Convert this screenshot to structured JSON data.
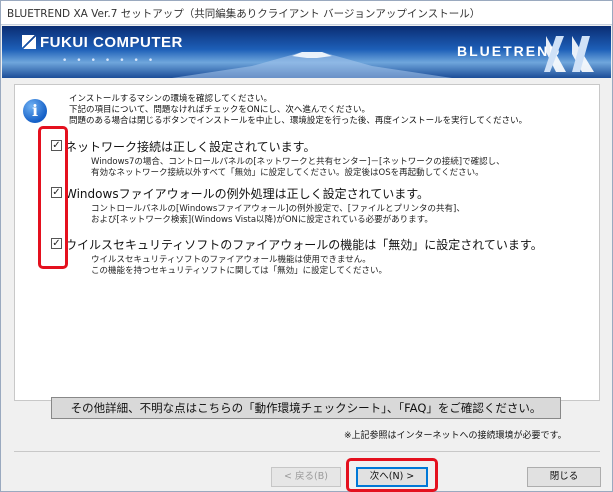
{
  "window": {
    "title": "BLUETREND XA Ver.7 セットアップ（共同編集ありクライアント バージョンアップインストール）"
  },
  "banner": {
    "logo_text": "FUKUI COMPUTER",
    "brand_text": "BLUETREND",
    "brand_mark": "XA",
    "accent_color": "#1d5fb8"
  },
  "intro": {
    "icon": "info-icon",
    "text": "インストールするマシンの環境を確認してください。\n下記の項目について、問題なければチェックをONにし、次へ進んでください。\n問題のある場合は閉じるボタンでインストールを中止し、環境設定を行った後、再度インストールを実行してください。"
  },
  "checks": [
    {
      "checked": true,
      "label": "ネットワーク接続は正しく設定されています。",
      "desc": "Windows7の場合、コントロールパネルの[ネットワークと共有センター]－[ネットワークの接続]で確認し、\n有効なネットワーク接続以外すべて「無効」に設定してください。設定後はOSを再起動してください。"
    },
    {
      "checked": true,
      "label": "Windowsファイアウォールの例外処理は正しく設定されています。",
      "desc": "コントロールパネルの[Windowsファイアウォール]の例外設定で、[ファイルとプリンタの共有]、\nおよび[ネットワーク検索](Windows Vista以降)がONに設定されている必要があります。"
    },
    {
      "checked": true,
      "label": "ウイルスセキュリティソフトのファイアウォールの機能は「無効」に設定されています。",
      "desc": "ウイルスセキュリティソフトのファイアウォール機能は使用できません。\nこの機能を持つセキュリティソフトに関しては「無効」に設定してください。"
    }
  ],
  "notice": "その他詳細、不明な点はこちらの「動作環境チェックシート」、「FAQ」をご確認ください。",
  "note": "※上記参照はインターネットへの接続環境が必要です。",
  "buttons": {
    "back": "< 戻る(B)",
    "next": "次へ(N) >",
    "close": "閉じる"
  },
  "highlight_color": "#e4101e"
}
